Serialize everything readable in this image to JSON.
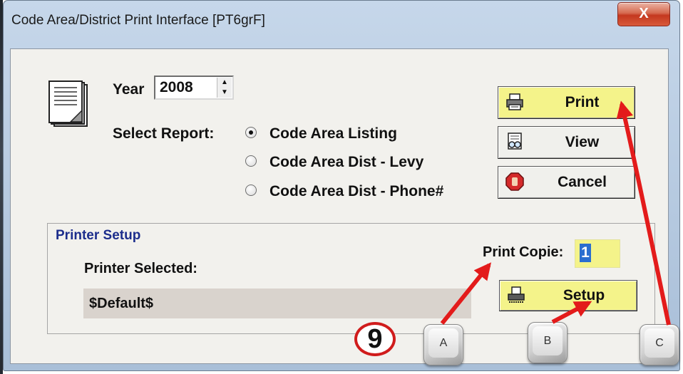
{
  "window": {
    "title": "Code Area/District Print Interface [PT6grF]",
    "close_label": "X"
  },
  "year": {
    "label": "Year",
    "value": "2008"
  },
  "report": {
    "label": "Select Report:",
    "options": [
      {
        "label": "Code Area Listing",
        "selected": true
      },
      {
        "label": "Code Area Dist - Levy",
        "selected": false
      },
      {
        "label": "Code Area Dist - Phone#",
        "selected": false
      }
    ]
  },
  "buttons": {
    "print": "Print",
    "view": "View",
    "cancel": "Cancel",
    "setup": "Setup"
  },
  "printer_setup": {
    "title": "Printer Setup",
    "printer_selected_label": "Printer Selected:",
    "printer_value": "$Default$",
    "copies_label": "Print Copie:",
    "copies_value": "1"
  },
  "annotations": {
    "step_number": "9",
    "keys": [
      "A",
      "B",
      "C"
    ],
    "arrow_color": "#e31b1b"
  },
  "colors": {
    "button_highlight": "#f4f38a",
    "group_title": "#1c2d8c",
    "selection": "#2a6ecf"
  }
}
